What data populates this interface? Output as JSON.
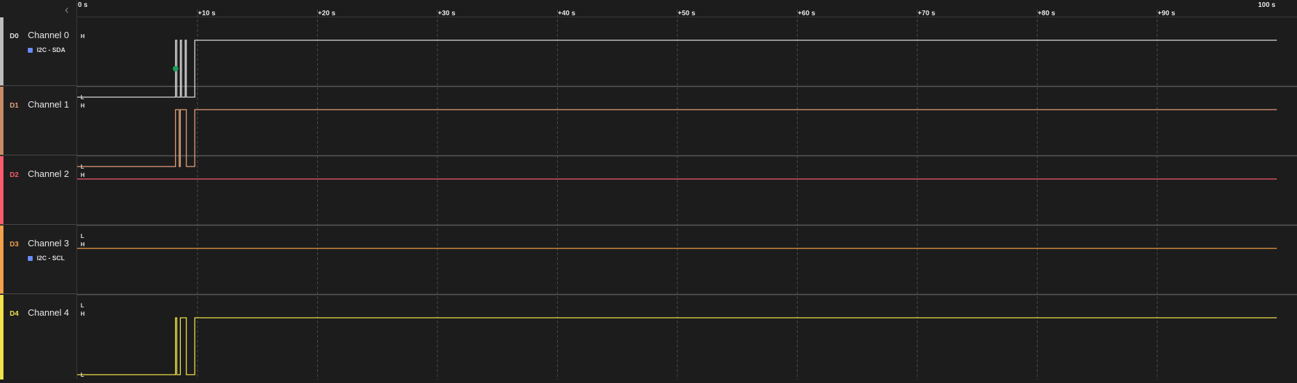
{
  "timeline": {
    "ticks": [
      "0 s",
      "+10 s",
      "+20 s",
      "+30 s",
      "+40 s",
      "+50 s",
      "+60 s",
      "+70 s",
      "+80 s",
      "+90 s",
      "100 s"
    ]
  },
  "level_labels": {
    "high": "H",
    "low": "L"
  },
  "channels": [
    {
      "tag": "D0",
      "name": "Channel 0",
      "color": "#e0e0e0",
      "strip_color": "#bdbdbd",
      "analyzer": "I2C - SDA",
      "marker": true,
      "signal": [
        [
          0,
          0
        ],
        [
          8.2,
          1
        ],
        [
          8.3,
          0
        ],
        [
          8.6,
          1
        ],
        [
          8.7,
          0
        ],
        [
          9.0,
          1
        ],
        [
          9.1,
          0
        ],
        [
          9.8,
          1
        ],
        [
          100,
          1
        ]
      ]
    },
    {
      "tag": "D1",
      "name": "Channel 1",
      "color": "#e8a27c",
      "strip_color": "#c98a66",
      "analyzer": "",
      "marker": false,
      "signal": [
        [
          0,
          0
        ],
        [
          8.2,
          1
        ],
        [
          8.5,
          0
        ],
        [
          8.6,
          1
        ],
        [
          9.1,
          0
        ],
        [
          9.8,
          1
        ],
        [
          100,
          1
        ]
      ]
    },
    {
      "tag": "D2",
      "name": "Channel 2",
      "color": "#ff5b6e",
      "strip_color": "#ff5b6e",
      "analyzer": "",
      "marker": false,
      "signal": [
        [
          0,
          1
        ],
        [
          100,
          1
        ]
      ]
    },
    {
      "tag": "D3",
      "name": "Channel 3",
      "color": "#f5a04a",
      "strip_color": "#f5a04a",
      "analyzer": "I2C - SCL",
      "marker": false,
      "signal": [
        [
          0,
          1
        ],
        [
          100,
          1
        ]
      ]
    },
    {
      "tag": "D4",
      "name": "Channel 4",
      "color": "#f2e34a",
      "strip_color": "#f2e34a",
      "analyzer": "",
      "marker": false,
      "signal": [
        [
          0,
          0
        ],
        [
          8.2,
          1
        ],
        [
          8.3,
          0
        ],
        [
          8.6,
          1
        ],
        [
          9.1,
          0
        ],
        [
          9.8,
          1
        ],
        [
          100,
          1
        ]
      ]
    }
  ],
  "colors": {
    "background": "#1c1c1c",
    "grid": "#4a4a4a",
    "separator": "#5a5a5a",
    "marker": "#1e9e5a"
  }
}
